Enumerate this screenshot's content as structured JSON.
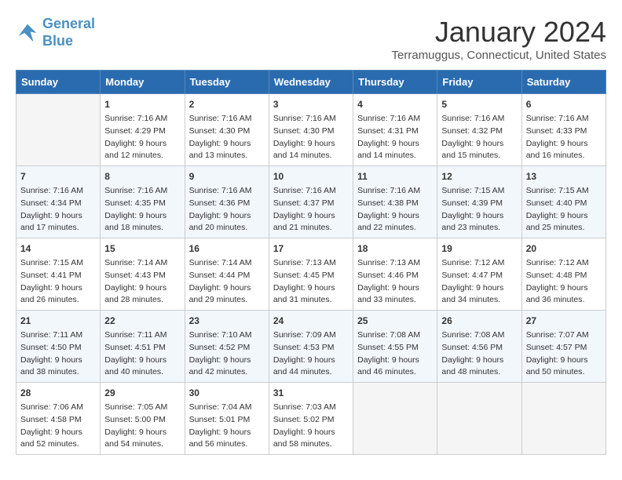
{
  "header": {
    "logo_line1": "General",
    "logo_line2": "Blue",
    "title": "January 2024",
    "subtitle": "Terramuggus, Connecticut, United States"
  },
  "weekdays": [
    "Sunday",
    "Monday",
    "Tuesday",
    "Wednesday",
    "Thursday",
    "Friday",
    "Saturday"
  ],
  "weeks": [
    [
      {
        "day": "",
        "sunrise": "",
        "sunset": "",
        "daylight": ""
      },
      {
        "day": "1",
        "sunrise": "7:16 AM",
        "sunset": "4:29 PM",
        "daylight": "9 hours and 12 minutes."
      },
      {
        "day": "2",
        "sunrise": "7:16 AM",
        "sunset": "4:30 PM",
        "daylight": "9 hours and 13 minutes."
      },
      {
        "day": "3",
        "sunrise": "7:16 AM",
        "sunset": "4:30 PM",
        "daylight": "9 hours and 14 minutes."
      },
      {
        "day": "4",
        "sunrise": "7:16 AM",
        "sunset": "4:31 PM",
        "daylight": "9 hours and 14 minutes."
      },
      {
        "day": "5",
        "sunrise": "7:16 AM",
        "sunset": "4:32 PM",
        "daylight": "9 hours and 15 minutes."
      },
      {
        "day": "6",
        "sunrise": "7:16 AM",
        "sunset": "4:33 PM",
        "daylight": "9 hours and 16 minutes."
      }
    ],
    [
      {
        "day": "7",
        "sunrise": "7:16 AM",
        "sunset": "4:34 PM",
        "daylight": "9 hours and 17 minutes."
      },
      {
        "day": "8",
        "sunrise": "7:16 AM",
        "sunset": "4:35 PM",
        "daylight": "9 hours and 18 minutes."
      },
      {
        "day": "9",
        "sunrise": "7:16 AM",
        "sunset": "4:36 PM",
        "daylight": "9 hours and 20 minutes."
      },
      {
        "day": "10",
        "sunrise": "7:16 AM",
        "sunset": "4:37 PM",
        "daylight": "9 hours and 21 minutes."
      },
      {
        "day": "11",
        "sunrise": "7:16 AM",
        "sunset": "4:38 PM",
        "daylight": "9 hours and 22 minutes."
      },
      {
        "day": "12",
        "sunrise": "7:15 AM",
        "sunset": "4:39 PM",
        "daylight": "9 hours and 23 minutes."
      },
      {
        "day": "13",
        "sunrise": "7:15 AM",
        "sunset": "4:40 PM",
        "daylight": "9 hours and 25 minutes."
      }
    ],
    [
      {
        "day": "14",
        "sunrise": "7:15 AM",
        "sunset": "4:41 PM",
        "daylight": "9 hours and 26 minutes."
      },
      {
        "day": "15",
        "sunrise": "7:14 AM",
        "sunset": "4:43 PM",
        "daylight": "9 hours and 28 minutes."
      },
      {
        "day": "16",
        "sunrise": "7:14 AM",
        "sunset": "4:44 PM",
        "daylight": "9 hours and 29 minutes."
      },
      {
        "day": "17",
        "sunrise": "7:13 AM",
        "sunset": "4:45 PM",
        "daylight": "9 hours and 31 minutes."
      },
      {
        "day": "18",
        "sunrise": "7:13 AM",
        "sunset": "4:46 PM",
        "daylight": "9 hours and 33 minutes."
      },
      {
        "day": "19",
        "sunrise": "7:12 AM",
        "sunset": "4:47 PM",
        "daylight": "9 hours and 34 minutes."
      },
      {
        "day": "20",
        "sunrise": "7:12 AM",
        "sunset": "4:48 PM",
        "daylight": "9 hours and 36 minutes."
      }
    ],
    [
      {
        "day": "21",
        "sunrise": "7:11 AM",
        "sunset": "4:50 PM",
        "daylight": "9 hours and 38 minutes."
      },
      {
        "day": "22",
        "sunrise": "7:11 AM",
        "sunset": "4:51 PM",
        "daylight": "9 hours and 40 minutes."
      },
      {
        "day": "23",
        "sunrise": "7:10 AM",
        "sunset": "4:52 PM",
        "daylight": "9 hours and 42 minutes."
      },
      {
        "day": "24",
        "sunrise": "7:09 AM",
        "sunset": "4:53 PM",
        "daylight": "9 hours and 44 minutes."
      },
      {
        "day": "25",
        "sunrise": "7:08 AM",
        "sunset": "4:55 PM",
        "daylight": "9 hours and 46 minutes."
      },
      {
        "day": "26",
        "sunrise": "7:08 AM",
        "sunset": "4:56 PM",
        "daylight": "9 hours and 48 minutes."
      },
      {
        "day": "27",
        "sunrise": "7:07 AM",
        "sunset": "4:57 PM",
        "daylight": "9 hours and 50 minutes."
      }
    ],
    [
      {
        "day": "28",
        "sunrise": "7:06 AM",
        "sunset": "4:58 PM",
        "daylight": "9 hours and 52 minutes."
      },
      {
        "day": "29",
        "sunrise": "7:05 AM",
        "sunset": "5:00 PM",
        "daylight": "9 hours and 54 minutes."
      },
      {
        "day": "30",
        "sunrise": "7:04 AM",
        "sunset": "5:01 PM",
        "daylight": "9 hours and 56 minutes."
      },
      {
        "day": "31",
        "sunrise": "7:03 AM",
        "sunset": "5:02 PM",
        "daylight": "9 hours and 58 minutes."
      },
      {
        "day": "",
        "sunrise": "",
        "sunset": "",
        "daylight": ""
      },
      {
        "day": "",
        "sunrise": "",
        "sunset": "",
        "daylight": ""
      },
      {
        "day": "",
        "sunrise": "",
        "sunset": "",
        "daylight": ""
      }
    ]
  ],
  "labels": {
    "sunrise": "Sunrise:",
    "sunset": "Sunset:",
    "daylight": "Daylight:"
  }
}
